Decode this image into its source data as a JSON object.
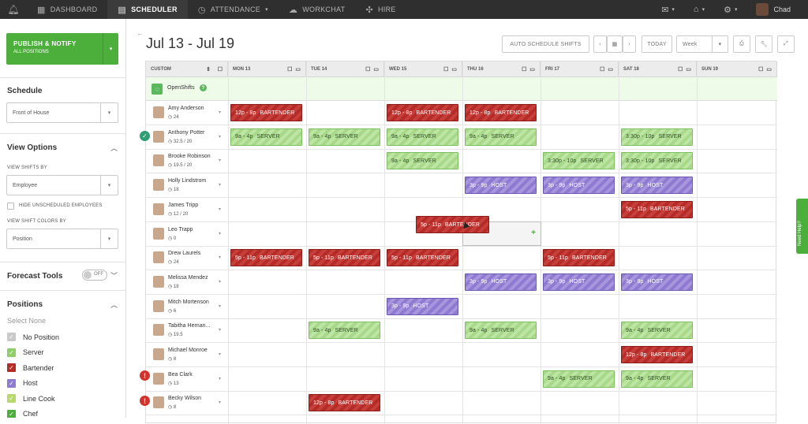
{
  "nav": {
    "items": [
      {
        "label": "DASHBOARD",
        "icon": "dashboard-icon",
        "glyph": "▦",
        "active": false
      },
      {
        "label": "SCHEDULER",
        "icon": "calendar-icon",
        "glyph": "▤",
        "active": true
      },
      {
        "label": "ATTENDANCE",
        "icon": "clock-icon",
        "glyph": "◷",
        "active": false,
        "caret": "▾"
      },
      {
        "label": "WORKCHAT",
        "icon": "chat-icon",
        "glyph": "☁",
        "active": false
      },
      {
        "label": "HIRE",
        "icon": "hire-icon",
        "glyph": "✣",
        "active": false
      }
    ],
    "user_name": "Chad"
  },
  "sidebar": {
    "publish_label": "PUBLISH & NOTIFY",
    "publish_sub": "ALL POSITIONS",
    "schedule_heading": "Schedule",
    "schedule_value": "Front of House",
    "view_options_heading": "View Options",
    "view_shifts_by_label": "VIEW SHIFTS BY",
    "view_shifts_by_value": "Employee",
    "hide_unscheduled_label": "HIDE UNSCHEDULED EMPLOYEES",
    "view_colors_label": "VIEW SHIFT COLORS BY",
    "view_colors_value": "Position",
    "forecast_label": "Forecast Tools",
    "forecast_toggle": "OFF",
    "positions_heading": "Positions",
    "select_none": "Select None",
    "positions": [
      {
        "label": "No Position",
        "color": "#c9c9c9"
      },
      {
        "label": "Server",
        "color": "#8fcf6a"
      },
      {
        "label": "Bartender",
        "color": "#b52b27"
      },
      {
        "label": "Host",
        "color": "#8e7ad0"
      },
      {
        "label": "Line Cook",
        "color": "#b7d96b"
      },
      {
        "label": "Chef",
        "color": "#4caf3c"
      }
    ]
  },
  "header": {
    "date_range": "Jul 13 - Jul 19",
    "auto_schedule_label": "AUTO SCHEDULE SHIFTS",
    "today_label": "TODAY",
    "view_value": "Week"
  },
  "grid": {
    "custom_label": "CUSTOM",
    "days": [
      "MON 13",
      "TUE 14",
      "WED 15",
      "THU 16",
      "FRI 17",
      "SAT 18",
      "SUN 19"
    ],
    "openshifts_label": "OpenShifts",
    "employees": [
      {
        "name": "Amy Anderson",
        "hours": "24",
        "status": "none"
      },
      {
        "name": "Anthony Potter",
        "hours": "32.5 / 20",
        "status": "check"
      },
      {
        "name": "Brooke Robinson",
        "hours": "19.5 / 20",
        "status": "none"
      },
      {
        "name": "Holly Lindstrom",
        "hours": "18",
        "status": "none"
      },
      {
        "name": "James Tripp",
        "hours": "12 / 20",
        "status": "none"
      },
      {
        "name": "Leo Trapp",
        "hours": "0",
        "status": "none"
      },
      {
        "name": "Drew Laurels",
        "hours": "24",
        "status": "none"
      },
      {
        "name": "Melissa Mendez",
        "hours": "18",
        "status": "none"
      },
      {
        "name": "Mitch Mortenson",
        "hours": "6",
        "status": "none"
      },
      {
        "name": "Tabitha Hernan...",
        "hours": "19.5",
        "status": "none"
      },
      {
        "name": "Michael Monroe",
        "hours": "8",
        "status": "none"
      },
      {
        "name": "Bea Clark",
        "hours": "13",
        "status": "warn"
      },
      {
        "name": "Becky Wilson",
        "hours": "8",
        "status": "warn"
      }
    ],
    "shifts": [
      {
        "row": 0,
        "day": 0,
        "time": "12p - 8p",
        "role": "BARTENDER",
        "type": "bartender"
      },
      {
        "row": 0,
        "day": 2,
        "time": "12p - 8p",
        "role": "BARTENDER",
        "type": "bartender"
      },
      {
        "row": 0,
        "day": 3,
        "time": "12p - 8p",
        "role": "BARTENDER",
        "type": "bartender"
      },
      {
        "row": 1,
        "day": 0,
        "time": "9a - 4p",
        "role": "SERVER",
        "type": "server"
      },
      {
        "row": 1,
        "day": 1,
        "time": "9a - 4p",
        "role": "SERVER",
        "type": "server"
      },
      {
        "row": 1,
        "day": 2,
        "time": "9a - 4p",
        "role": "SERVER",
        "type": "server"
      },
      {
        "row": 1,
        "day": 3,
        "time": "9a - 4p",
        "role": "SERVER",
        "type": "server"
      },
      {
        "row": 1,
        "day": 5,
        "time": "3:30p - 10p",
        "role": "SERVER",
        "type": "server"
      },
      {
        "row": 2,
        "day": 2,
        "time": "9a - 4p",
        "role": "SERVER",
        "type": "server"
      },
      {
        "row": 2,
        "day": 4,
        "time": "3:30p - 10p",
        "role": "SERVER",
        "type": "server"
      },
      {
        "row": 2,
        "day": 5,
        "time": "3:30p - 10p",
        "role": "SERVER",
        "type": "server"
      },
      {
        "row": 3,
        "day": 3,
        "time": "3p - 9p",
        "role": "HOST",
        "type": "host"
      },
      {
        "row": 3,
        "day": 4,
        "time": "3p - 9p",
        "role": "HOST",
        "type": "host"
      },
      {
        "row": 3,
        "day": 5,
        "time": "3p - 9p",
        "role": "HOST",
        "type": "host"
      },
      {
        "row": 4,
        "day": 5,
        "time": "5p - 11p",
        "role": "BARTENDER",
        "type": "bartender"
      },
      {
        "row": 6,
        "day": 0,
        "time": "5p - 11p",
        "role": "BARTENDER",
        "type": "bartender"
      },
      {
        "row": 6,
        "day": 1,
        "time": "5p - 11p",
        "role": "BARTENDER",
        "type": "bartender"
      },
      {
        "row": 6,
        "day": 2,
        "time": "5p - 11p",
        "role": "BARTENDER",
        "type": "bartender"
      },
      {
        "row": 6,
        "day": 4,
        "time": "5p - 11p",
        "role": "BARTENDER",
        "type": "bartender"
      },
      {
        "row": 7,
        "day": 3,
        "time": "3p - 9p",
        "role": "HOST",
        "type": "host"
      },
      {
        "row": 7,
        "day": 4,
        "time": "3p - 9p",
        "role": "HOST",
        "type": "host"
      },
      {
        "row": 7,
        "day": 5,
        "time": "3p - 9p",
        "role": "HOST",
        "type": "host"
      },
      {
        "row": 8,
        "day": 2,
        "time": "3p - 9p",
        "role": "HOST",
        "type": "host"
      },
      {
        "row": 9,
        "day": 1,
        "time": "9a - 4p",
        "role": "SERVER",
        "type": "server"
      },
      {
        "row": 9,
        "day": 3,
        "time": "9a - 4p",
        "role": "SERVER",
        "type": "server"
      },
      {
        "row": 9,
        "day": 5,
        "time": "9a - 4p",
        "role": "SERVER",
        "type": "server"
      },
      {
        "row": 10,
        "day": 5,
        "time": "12p - 8p",
        "role": "BARTENDER",
        "type": "bartender"
      },
      {
        "row": 11,
        "day": 4,
        "time": "9a - 4p",
        "role": "SERVER",
        "type": "server"
      },
      {
        "row": 11,
        "day": 5,
        "time": "9a - 4p",
        "role": "SERVER",
        "type": "server"
      },
      {
        "row": 12,
        "day": 1,
        "time": "12p - 8p",
        "role": "BARTENDER",
        "type": "bartender"
      }
    ],
    "dragging_shift": {
      "time": "5p - 11p",
      "role": "BARTENDER",
      "type": "bartender"
    }
  },
  "help_tab": "Need Help?"
}
